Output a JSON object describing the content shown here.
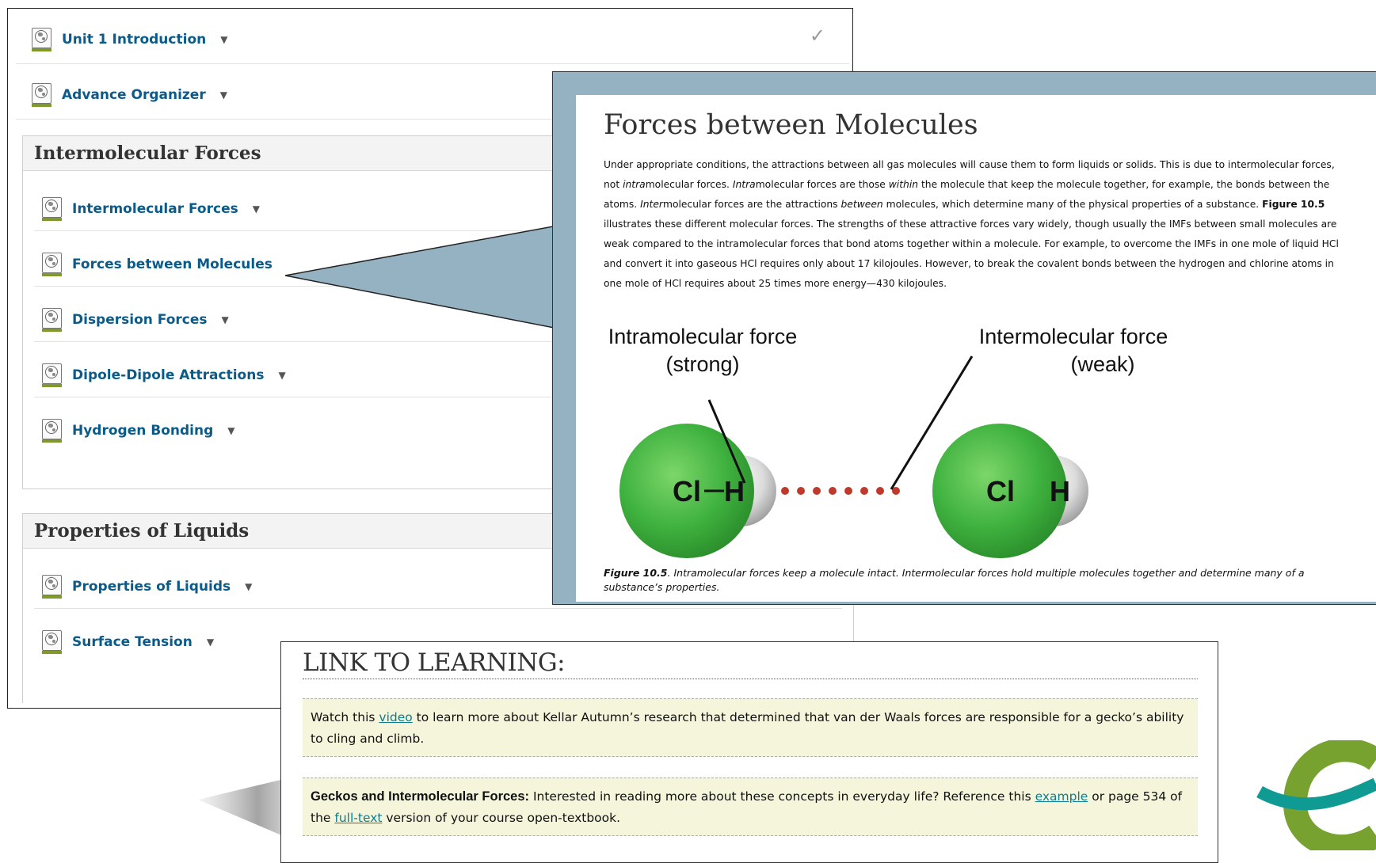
{
  "course_outline": {
    "top_items": [
      {
        "label": "Unit 1 Introduction",
        "completed": true
      },
      {
        "label": "Advance Organizer"
      }
    ],
    "modules": [
      {
        "title": "Intermolecular Forces",
        "items": [
          {
            "label": "Intermolecular Forces"
          },
          {
            "label": "Forces between Molecules"
          },
          {
            "label": "Dispersion Forces"
          },
          {
            "label": "Dipole-Dipole Attractions"
          },
          {
            "label": "Hydrogen Bonding"
          }
        ]
      },
      {
        "title": "Properties of Liquids",
        "items": [
          {
            "label": "Properties of Liquids"
          },
          {
            "label": "Surface Tension"
          }
        ]
      }
    ],
    "icons": {
      "item": "page-globe-icon",
      "menu": "caret-down-icon",
      "completed": "checkmark-icon"
    },
    "colors": {
      "link": "#0b5b8a",
      "icon_bar": "#7f9a2b"
    }
  },
  "excerpt": {
    "title": "Forces between Molecules",
    "paragraph": [
      {
        "t": "Under appropriate conditions, the attractions between all gas molecules will cause them to form liquids or solids. This is due to intermolecular forces, not "
      },
      {
        "t": "intra",
        "style": "i"
      },
      {
        "t": "molecular forces. "
      },
      {
        "t": "Intra",
        "style": "i"
      },
      {
        "t": "molecular forces are those "
      },
      {
        "t": "within",
        "style": "i"
      },
      {
        "t": " the molecule that keep the molecule together, for example, the bonds between the atoms. "
      },
      {
        "t": "Inter",
        "style": "i"
      },
      {
        "t": "molecular forces are the attractions "
      },
      {
        "t": "between",
        "style": "i"
      },
      {
        "t": " molecules, which determine many of the physical properties of a substance. "
      },
      {
        "t": "Figure 10.5",
        "style": "b"
      },
      {
        "t": " illustrates these different molecular forces. The strengths of these attractive forces vary widely, though usually the IMFs between small molecules are weak compared to the intramolecular forces that bond atoms together within a molecule. For example, to overcome the IMFs in one mole of liquid HCl and convert it into gaseous HCl requires only about 17 kilojoules. However, to break the covalent bonds between the hydrogen and chlorine atoms in one mole of HCl requires about 25 times more energy—430 kilojoules."
      }
    ],
    "figure": {
      "intra_label_1": "Intramolecular force",
      "intra_label_2": "(strong)",
      "inter_label_1": "Intermolecular force",
      "inter_label_2": "(weak)",
      "atom_cl": "Cl",
      "atom_h": "H",
      "colors": {
        "chlorine": "#3fb23f",
        "hydrogen": "#e8e8e8",
        "dots": "#c0392b",
        "frame": "#94b2c1"
      }
    },
    "caption": {
      "label": "Figure 10.5",
      "text": ". Intramolecular forces keep a molecule intact. Intermolecular forces hold multiple molecules together and determine many of a substance’s properties."
    }
  },
  "link_to_learning": {
    "title": "LINK TO LEARNING:",
    "box1": [
      {
        "t": "Watch this "
      },
      {
        "t": "video",
        "style": "a"
      },
      {
        "t": " to learn more about Kellar Autumn’s research that determined that van der Waals forces are responsible for a gecko’s ability to cling and climb."
      }
    ],
    "box2": [
      {
        "t": "Geckos and Intermolecular Forces:",
        "style": "b"
      },
      {
        "t": " Interested in reading more about these concepts in everyday life? Reference this "
      },
      {
        "t": "example",
        "style": "a"
      },
      {
        "t": " or page 534 of the "
      },
      {
        "t": "full-text",
        "style": "a"
      },
      {
        "t": " version of your course open-textbook."
      }
    ],
    "colors": {
      "box_bg": "#f5f5dc",
      "link": "#0b7f8f"
    }
  },
  "logo": {
    "icon": "open-textbook-logo-icon",
    "colors": {
      "green": "#77a22f",
      "teal": "#0f9a93"
    }
  }
}
